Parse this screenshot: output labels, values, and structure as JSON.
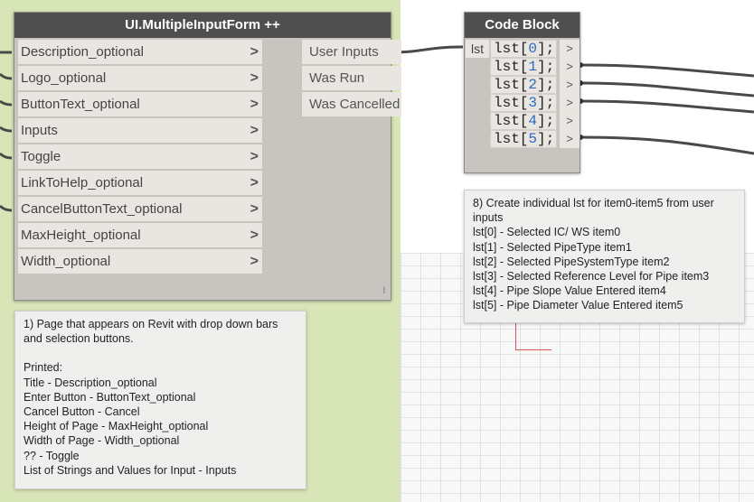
{
  "multiple_input_form": {
    "title": "UI.MultipleInputForm ++",
    "inputs": [
      "Description_optional",
      "Logo_optional",
      "ButtonText_optional",
      "Inputs",
      "Toggle",
      "LinkToHelp_optional",
      "CancelButtonText_optional",
      "MaxHeight_optional",
      "Width_optional"
    ],
    "input_arrow": ">",
    "outputs": [
      "User Inputs",
      "Was Run",
      "Was Cancelled"
    ],
    "resize_mark": "l"
  },
  "code_block": {
    "title": "Code Block",
    "input_label": "lst",
    "lines": [
      {
        "prefix": "lst[",
        "index": "0",
        "suffix": "];"
      },
      {
        "prefix": "lst[",
        "index": "1",
        "suffix": "];"
      },
      {
        "prefix": "lst[",
        "index": "2",
        "suffix": "];"
      },
      {
        "prefix": "lst[",
        "index": "3",
        "suffix": "];"
      },
      {
        "prefix": "lst[",
        "index": "4",
        "suffix": "];"
      },
      {
        "prefix": "lst[",
        "index": "5",
        "suffix": "];"
      }
    ],
    "output_arrow": ">"
  },
  "note_left": {
    "lines": [
      "1) Page that appears on Revit with drop down bars",
      "and selection buttons.",
      "",
      "Printed:",
      "Title - Description_optional",
      "Enter Button - ButtonText_optional",
      "Cancel Button - Cancel",
      "Height of Page - MaxHeight_optional",
      "Width of Page - Width_optional",
      "?? - Toggle",
      "List of Strings and Values for Input - Inputs"
    ]
  },
  "note_right": {
    "lines": [
      "8) Create individual lst for item0-item5 from user",
      "inputs",
      "lst[0] - Selected IC/ WS item0",
      "lst[1] - Selected PipeType item1",
      "lst[2] - Selected PipeSystemType item2",
      "lst[3] - Selected Reference Level for Pipe item3",
      "lst[4] - Pipe Slope Value Entered item4",
      "lst[5] - Pipe Diameter Value Entered item5"
    ]
  },
  "colors": {
    "group_background": "#d8e5b6",
    "node_header": "#4f4f4f",
    "node_body": "#c8c4bf",
    "port_background": "#e9e6e2",
    "code_index": "#2a6bbf",
    "wire": "#4a4a4a"
  }
}
